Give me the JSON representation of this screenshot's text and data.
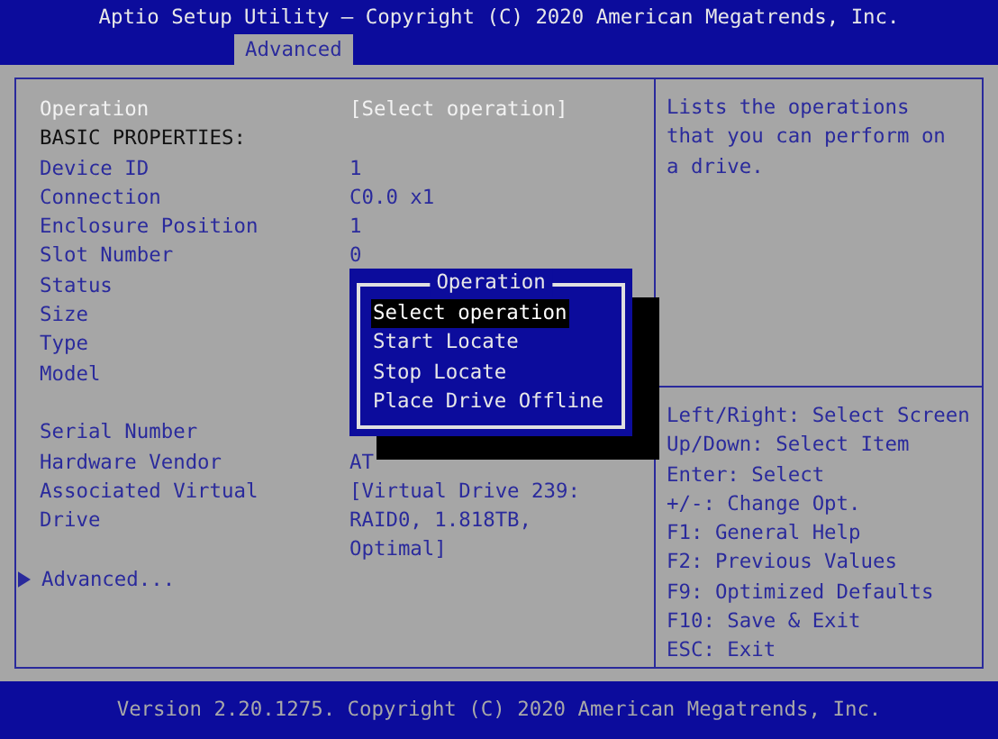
{
  "window": {
    "title": "Aptio Setup Utility – Copyright (C) 2020 American Megatrends, Inc."
  },
  "tabs": [
    {
      "label": "Advanced",
      "selected": true
    }
  ],
  "rows": [
    {
      "kind": "option",
      "label": "Operation",
      "value": "[Select operation]",
      "selected": true
    },
    {
      "kind": "heading",
      "label": "BASIC PROPERTIES:"
    },
    {
      "kind": "property",
      "label": "Device ID",
      "value": "1"
    },
    {
      "kind": "property",
      "label": "Connection",
      "value": "C0.0 x1"
    },
    {
      "kind": "property",
      "label": "Enclosure Position",
      "value": "1"
    },
    {
      "kind": "property",
      "label": "Slot Number",
      "value": "0"
    },
    {
      "kind": "property",
      "label": "Status"
    },
    {
      "kind": "property",
      "label": "Size"
    },
    {
      "kind": "property",
      "label": "Type"
    },
    {
      "kind": "property",
      "label": "Model"
    },
    {
      "kind": "blank"
    },
    {
      "kind": "property",
      "label": "Serial Number"
    },
    {
      "kind": "property",
      "label": "Hardware Vendor",
      "value": "AT"
    },
    {
      "kind": "property",
      "label": "Associated Virtual Drive",
      "value": "[Virtual Drive 239: RAID0, 1.818TB, Optimal]"
    },
    {
      "kind": "submenu",
      "label": "Advanced..."
    }
  ],
  "popup": {
    "title": "Operation",
    "options": [
      {
        "label": "Select operation",
        "selected": true
      },
      {
        "label": "Start Locate",
        "selected": false
      },
      {
        "label": "Stop Locate",
        "selected": false
      },
      {
        "label": "Place Drive Offline",
        "selected": false
      }
    ]
  },
  "help": "Lists the operations that you can perform on a drive.",
  "keys": [
    "Left/Right: Select Screen",
    "Up/Down: Select Item",
    "Enter: Select",
    "+/-: Change Opt.",
    "F1: General Help",
    "F2: Previous Values",
    "F9: Optimized Defaults",
    "F10: Save & Exit",
    "ESC: Exit"
  ],
  "status_bar": "Version 2.20.1275. Copyright (C) 2020 American Megatrends, Inc."
}
